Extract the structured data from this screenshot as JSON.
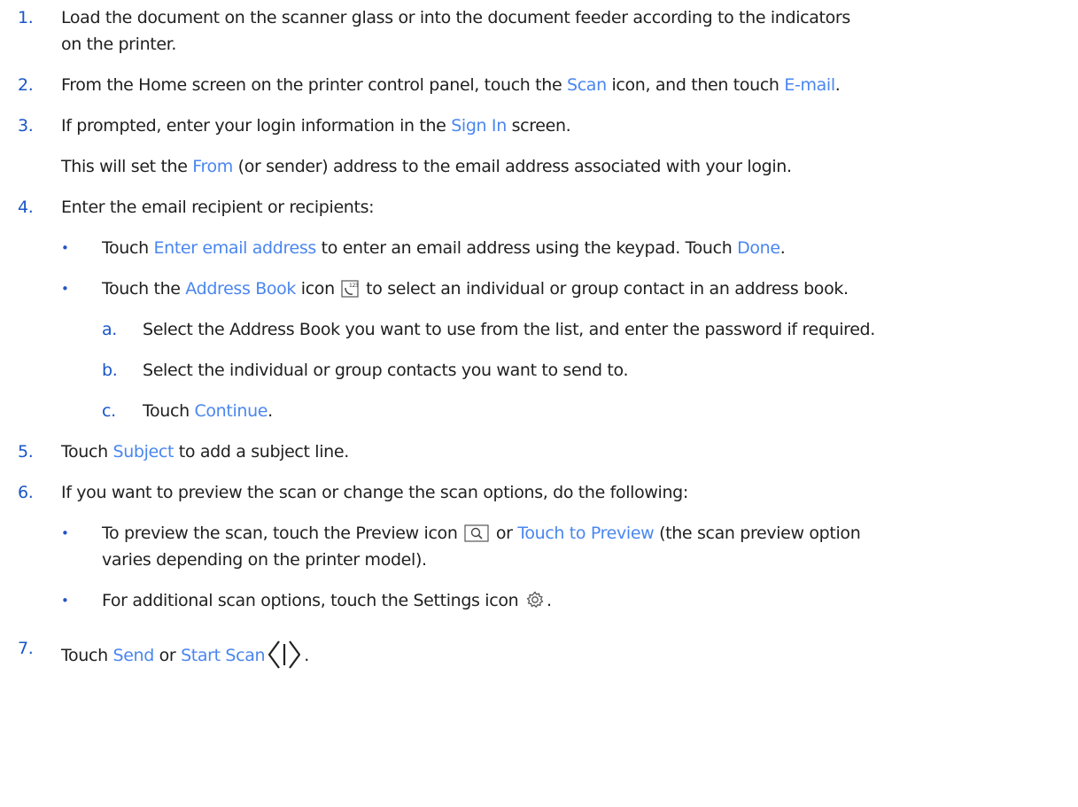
{
  "steps": {
    "s1": {
      "num": "1.",
      "line1": "Load the document on the scanner glass or into the document feeder according to the indicators",
      "line2": "on the printer."
    },
    "s2": {
      "num": "2.",
      "t1": "From the Home screen on the printer control panel, touch the ",
      "k1": "Scan",
      "t2": " icon, and then touch ",
      "k2": "E-mail",
      "t3": "."
    },
    "s3": {
      "num": "3.",
      "t1": "If prompted, enter your login information in the ",
      "k1": "Sign In",
      "t2": " screen.",
      "note_t1": "This will set the ",
      "note_k1": "From",
      "note_t2": " (or sender) address to the email address associated with your login."
    },
    "s4": {
      "num": "4.",
      "text": "Enter the email recipient or recipients:",
      "b1": {
        "bullet": "•",
        "t1": "Touch ",
        "k1": "Enter email address",
        "t2": " to enter an email address using the keypad. Touch ",
        "k2": "Done",
        "t3": "."
      },
      "b2": {
        "bullet": "•",
        "t1": "Touch the ",
        "k1": "Address Book",
        "t2": " icon ",
        "icon": "address-book-icon",
        "t3": " to select an individual or group contact in an address book."
      },
      "a": {
        "label": "a.",
        "text": "Select the Address Book you want to use from the list, and enter the password if required."
      },
      "b": {
        "label": "b.",
        "text": "Select the individual or group contacts you want to send to."
      },
      "c": {
        "label": "c.",
        "t1": "Touch ",
        "k1": "Continue",
        "t2": "."
      }
    },
    "s5": {
      "num": "5.",
      "t1": "Touch ",
      "k1": "Subject",
      "t2": " to add a subject line."
    },
    "s6": {
      "num": "6.",
      "text": "If you want to preview the scan or change the scan options, do the following:",
      "b1": {
        "bullet": "•",
        "t1": "To preview the scan, touch the Preview icon ",
        "icon": "preview-icon",
        "t2": " or ",
        "k1": "Touch to Preview",
        "t3": " (the scan preview option",
        "line2": "varies depending on the printer model)."
      },
      "b2": {
        "bullet": "•",
        "t1": "For additional scan options, touch the Settings icon ",
        "icon": "settings-icon",
        "t2": "."
      }
    },
    "s7": {
      "num": "7.",
      "t1": "Touch ",
      "k1": "Send",
      "t2": " or ",
      "k2": "Start Scan",
      "icon": "start-scan-icon",
      "t3": "."
    }
  },
  "colors": {
    "text": "#1f1f1f",
    "number": "#1a56c8",
    "keyword": "#4a86ef"
  }
}
